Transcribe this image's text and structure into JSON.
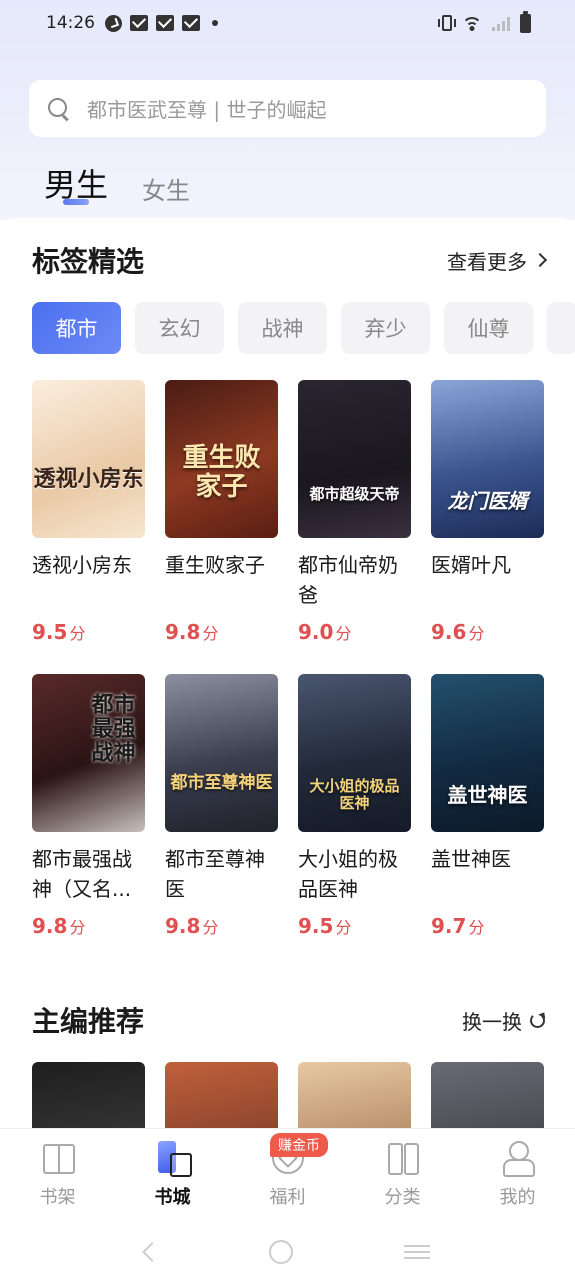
{
  "status_bar": {
    "time": "14:26"
  },
  "search": {
    "placeholder": "都市医武至尊 | 世子的崛起"
  },
  "gender_tabs": [
    {
      "label": "男生",
      "active": true
    },
    {
      "label": "女生",
      "active": false
    }
  ],
  "tag_section": {
    "title": "标签精选",
    "more_label": "查看更多",
    "tags": [
      "都市",
      "玄幻",
      "战神",
      "弃少",
      "仙尊"
    ],
    "books": [
      {
        "title": "透视小房东",
        "score": "9.5",
        "score_unit": "分",
        "cover_text": "透视小房东",
        "cover_color": "#f4e0c8"
      },
      {
        "title": "重生败家子",
        "score": "9.8",
        "score_unit": "分",
        "cover_text": "重生败家子",
        "cover_color": "#7a2a1c"
      },
      {
        "title": "都市仙帝奶爸",
        "score": "9.0",
        "score_unit": "分",
        "cover_text": "都市超级天帝",
        "cover_color": "#1f1a22"
      },
      {
        "title": "医婿叶凡",
        "score": "9.6",
        "score_unit": "分",
        "cover_text": "龙门医婿",
        "cover_color": "#2a3f7a"
      },
      {
        "title": "都市最强战神（又名...",
        "score": "9.8",
        "score_unit": "分",
        "cover_text": "都市最强战神",
        "cover_color": "#2b1a1a"
      },
      {
        "title": "都市至尊神医",
        "score": "9.8",
        "score_unit": "分",
        "cover_text": "都市至尊神医",
        "cover_color": "#3a3f4e"
      },
      {
        "title": "大小姐的极品医神",
        "score": "9.5",
        "score_unit": "分",
        "cover_text": "大小姐的极品医神",
        "cover_color": "#2b3850"
      },
      {
        "title": "盖世神医",
        "score": "9.7",
        "score_unit": "分",
        "cover_text": "盖世神医",
        "cover_color": "#14304a"
      }
    ]
  },
  "editor_section": {
    "title": "主编推荐",
    "refresh_label": "换一换",
    "cover_colors": [
      "#2b2b2b",
      "#7a3a2a",
      "#c89a6a",
      "#3a3a44"
    ]
  },
  "bottom_nav": [
    {
      "label": "书架",
      "icon": "bookshelf-icon",
      "active": false
    },
    {
      "label": "书城",
      "icon": "bookstore-icon",
      "active": true
    },
    {
      "label": "福利",
      "icon": "welfare-icon",
      "active": false,
      "badge": "赚金币"
    },
    {
      "label": "分类",
      "icon": "category-icon",
      "active": false
    },
    {
      "label": "我的",
      "icon": "profile-icon",
      "active": false
    }
  ],
  "colors": {
    "accent": "#4a6ff0",
    "score": "#e05050",
    "badge": "#f05a4a"
  }
}
